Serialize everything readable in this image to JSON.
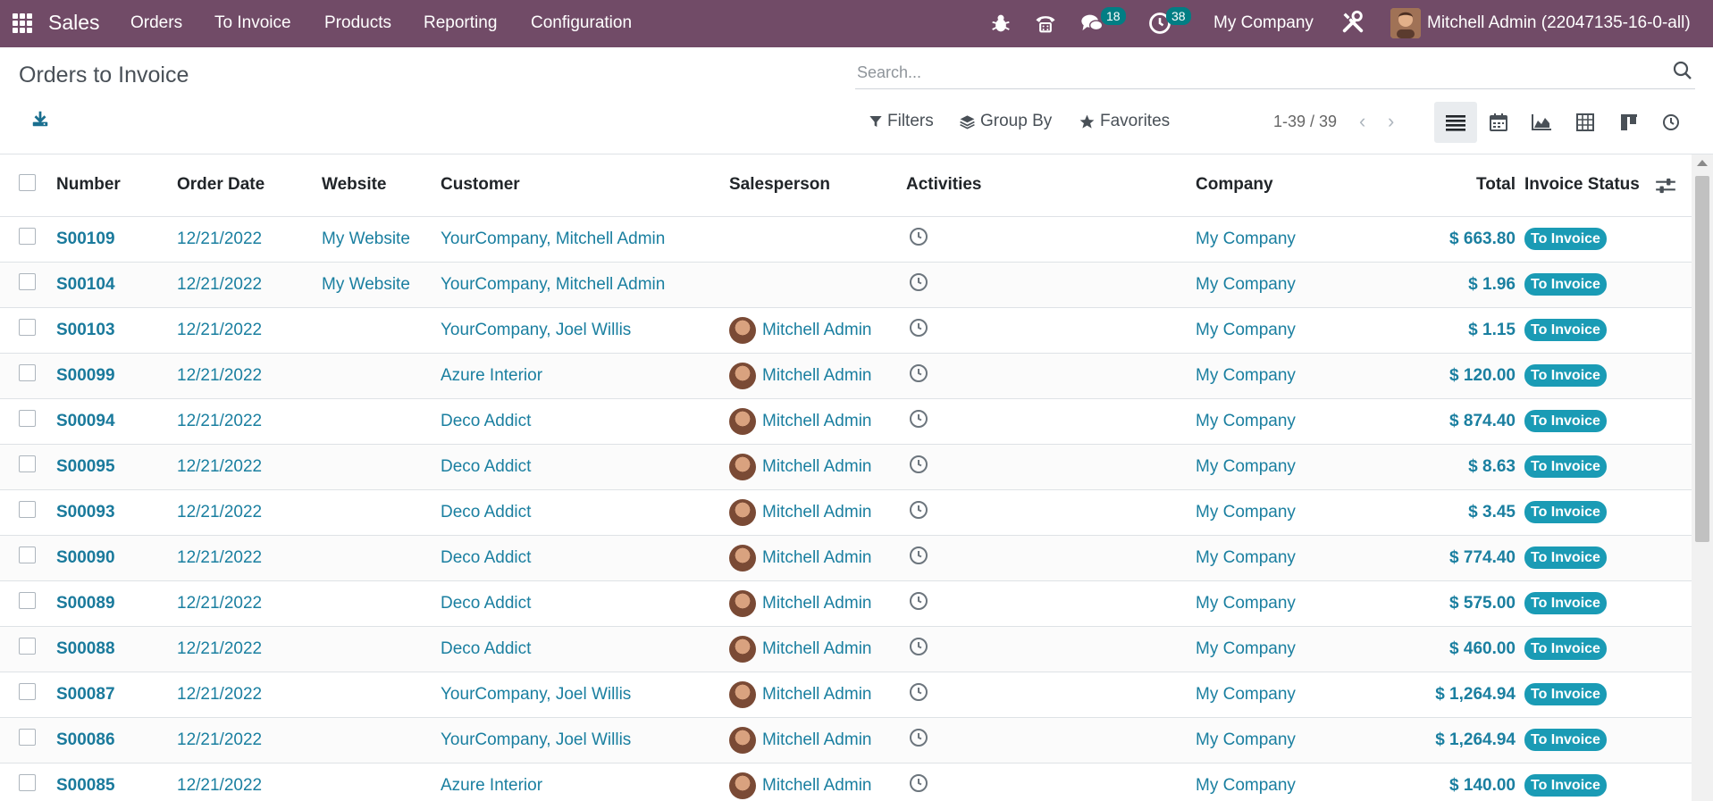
{
  "navbar": {
    "brand": "Sales",
    "menu": [
      "Orders",
      "To Invoice",
      "Products",
      "Reporting",
      "Configuration"
    ],
    "messages_count": "18",
    "activities_count": "38",
    "company": "My Company",
    "user": "Mitchell Admin (22047135-16-0-all)"
  },
  "control_panel": {
    "title": "Orders to Invoice",
    "search_placeholder": "Search...",
    "filters_label": "Filters",
    "groupby_label": "Group By",
    "favorites_label": "Favorites",
    "pager": "1-39 / 39"
  },
  "table": {
    "headers": {
      "number": "Number",
      "order_date": "Order Date",
      "website": "Website",
      "customer": "Customer",
      "salesperson": "Salesperson",
      "activities": "Activities",
      "company": "Company",
      "total": "Total",
      "invoice_status": "Invoice Status"
    },
    "rows": [
      {
        "number": "S00109",
        "date": "12/21/2022",
        "website": "My Website",
        "customer": "YourCompany, Mitchell Admin",
        "salesperson": "",
        "company": "My Company",
        "total": "$ 663.80",
        "status": "To Invoice"
      },
      {
        "number": "S00104",
        "date": "12/21/2022",
        "website": "My Website",
        "customer": "YourCompany, Mitchell Admin",
        "salesperson": "",
        "company": "My Company",
        "total": "$ 1.96",
        "status": "To Invoice"
      },
      {
        "number": "S00103",
        "date": "12/21/2022",
        "website": "",
        "customer": "YourCompany, Joel Willis",
        "salesperson": "Mitchell Admin",
        "company": "My Company",
        "total": "$ 1.15",
        "status": "To Invoice"
      },
      {
        "number": "S00099",
        "date": "12/21/2022",
        "website": "",
        "customer": "Azure Interior",
        "salesperson": "Mitchell Admin",
        "company": "My Company",
        "total": "$ 120.00",
        "status": "To Invoice"
      },
      {
        "number": "S00094",
        "date": "12/21/2022",
        "website": "",
        "customer": "Deco Addict",
        "salesperson": "Mitchell Admin",
        "company": "My Company",
        "total": "$ 874.40",
        "status": "To Invoice"
      },
      {
        "number": "S00095",
        "date": "12/21/2022",
        "website": "",
        "customer": "Deco Addict",
        "salesperson": "Mitchell Admin",
        "company": "My Company",
        "total": "$ 8.63",
        "status": "To Invoice"
      },
      {
        "number": "S00093",
        "date": "12/21/2022",
        "website": "",
        "customer": "Deco Addict",
        "salesperson": "Mitchell Admin",
        "company": "My Company",
        "total": "$ 3.45",
        "status": "To Invoice"
      },
      {
        "number": "S00090",
        "date": "12/21/2022",
        "website": "",
        "customer": "Deco Addict",
        "salesperson": "Mitchell Admin",
        "company": "My Company",
        "total": "$ 774.40",
        "status": "To Invoice"
      },
      {
        "number": "S00089",
        "date": "12/21/2022",
        "website": "",
        "customer": "Deco Addict",
        "salesperson": "Mitchell Admin",
        "company": "My Company",
        "total": "$ 575.00",
        "status": "To Invoice"
      },
      {
        "number": "S00088",
        "date": "12/21/2022",
        "website": "",
        "customer": "Deco Addict",
        "salesperson": "Mitchell Admin",
        "company": "My Company",
        "total": "$ 460.00",
        "status": "To Invoice"
      },
      {
        "number": "S00087",
        "date": "12/21/2022",
        "website": "",
        "customer": "YourCompany, Joel Willis",
        "salesperson": "Mitchell Admin",
        "company": "My Company",
        "total": "$ 1,264.94",
        "status": "To Invoice"
      },
      {
        "number": "S00086",
        "date": "12/21/2022",
        "website": "",
        "customer": "YourCompany, Joel Willis",
        "salesperson": "Mitchell Admin",
        "company": "My Company",
        "total": "$ 1,264.94",
        "status": "To Invoice"
      },
      {
        "number": "S00085",
        "date": "12/21/2022",
        "website": "",
        "customer": "Azure Interior",
        "salesperson": "Mitchell Admin",
        "company": "My Company",
        "total": "$ 140.00",
        "status": "To Invoice"
      }
    ]
  },
  "icons": {
    "apps": "apps-grid-icon",
    "debug": "bug-icon",
    "phone": "phone-icon",
    "messages": "chat-icon",
    "activities": "clock-icon",
    "settings": "tools-icon",
    "download": "download-icon",
    "search": "search-icon",
    "optional_columns": "sliders-icon"
  },
  "colors": {
    "navbar": "#714b67",
    "link": "#1a7fa0",
    "badge": "#1a9bb5",
    "counter": "#017e84"
  }
}
